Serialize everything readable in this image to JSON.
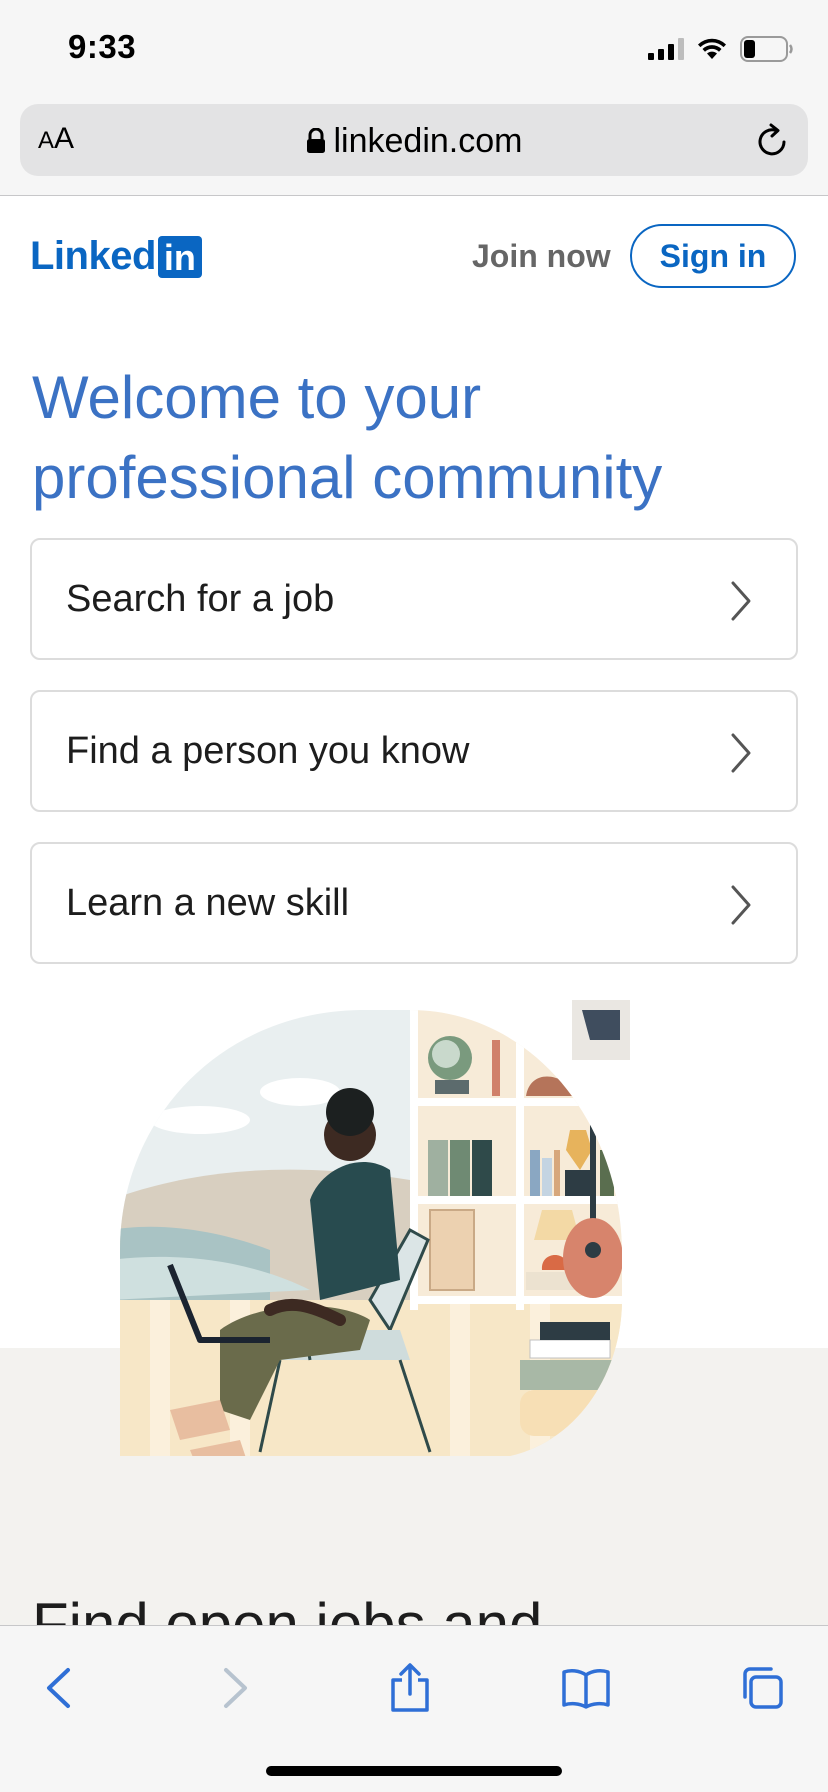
{
  "status_bar": {
    "time": "9:33"
  },
  "browser": {
    "aa_label_small": "A",
    "aa_label_large": "A",
    "url": "linkedin.com"
  },
  "header": {
    "logo_text": "Linked",
    "logo_box": "in",
    "join_now": "Join now",
    "sign_in": "Sign in"
  },
  "hero": {
    "headline": "Welcome to your professional community"
  },
  "options": [
    {
      "label": "Search for a job"
    },
    {
      "label": "Find a person you know"
    },
    {
      "label": "Learn a new skill"
    }
  ],
  "next_section": {
    "heading": "Find open jobs and"
  },
  "colors": {
    "brand": "#0a66c2",
    "headline": "#3b72c4",
    "toolbar_icon": "#2f6fd6"
  },
  "icons": {
    "lock": "lock-icon",
    "reload": "reload-icon",
    "chevron": "chevron-right-icon",
    "back": "back-icon",
    "forward": "forward-icon",
    "share": "share-icon",
    "bookmarks": "bookmarks-icon",
    "tabs": "tabs-icon"
  }
}
